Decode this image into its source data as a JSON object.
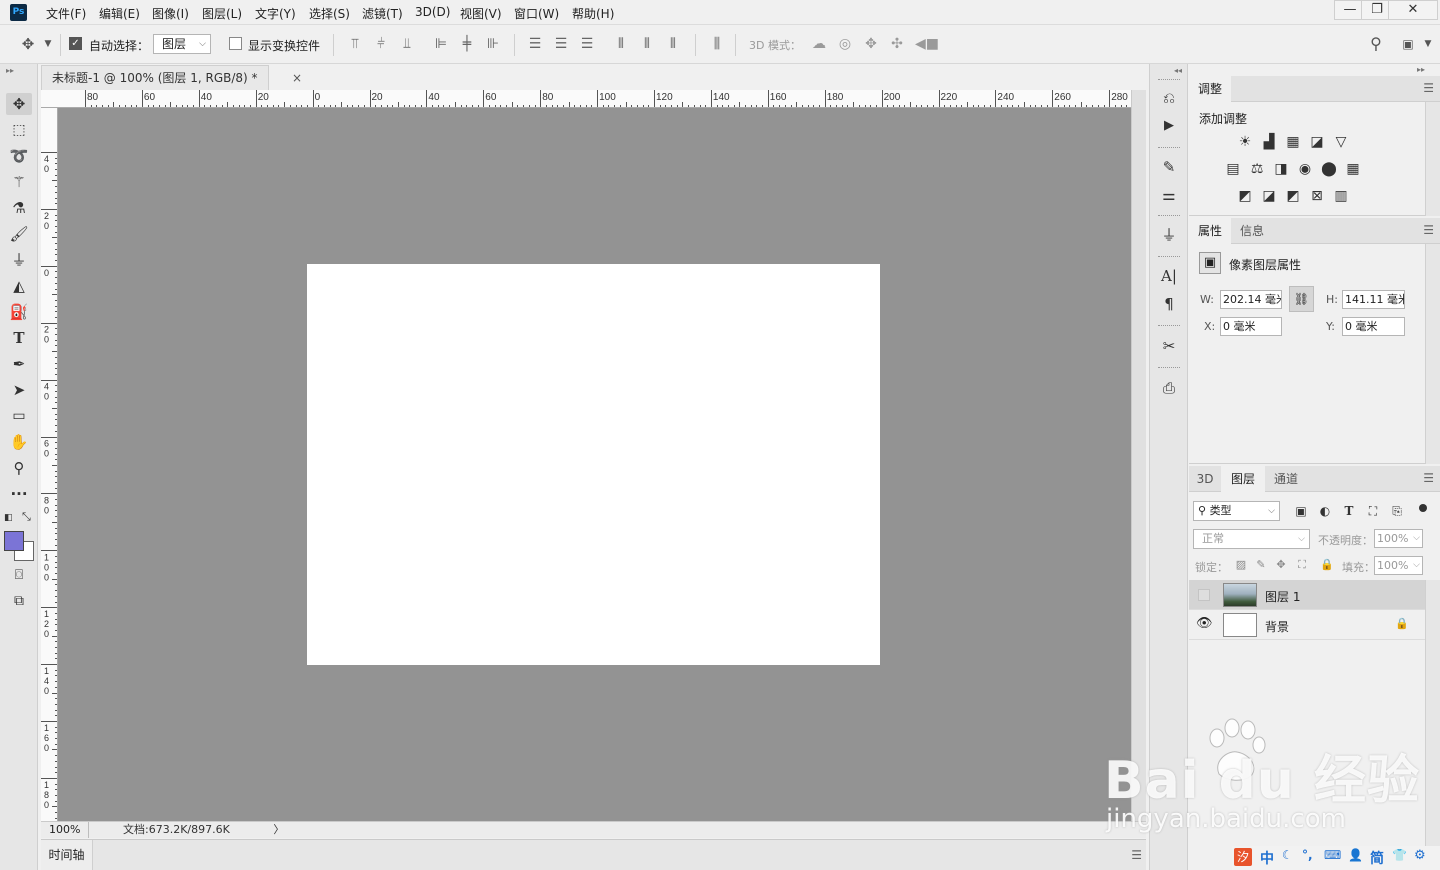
{
  "app": {
    "logo": "Ps"
  },
  "menu": [
    "文件(F)",
    "编辑(E)",
    "图像(I)",
    "图层(L)",
    "文字(Y)",
    "选择(S)",
    "滤镜(T)",
    "3D(D)",
    "视图(V)",
    "窗口(W)",
    "帮助(H)"
  ],
  "window_controls": {
    "minimize": "—",
    "restore": "❐",
    "close": "✕"
  },
  "options_bar": {
    "auto_select_label": "自动选择：",
    "auto_select_checked": true,
    "auto_select_target": "图层",
    "show_transform_label": "显示变换控件",
    "show_transform_checked": false,
    "mode_3d_label": "3D 模式："
  },
  "document": {
    "tab_title": "未标题-1 @ 100% (图层 1, RGB/8) *",
    "ruler_top_labels": [
      "80",
      "60",
      "40",
      "20",
      "0",
      "20",
      "40",
      "60",
      "80",
      "100",
      "120",
      "140",
      "160",
      "180",
      "200",
      "220",
      "240",
      "260",
      "280"
    ],
    "ruler_left_labels": [
      "4\n0",
      "2\n0",
      "0",
      "2\n0",
      "4\n0",
      "6\n0",
      "8\n0",
      "1\n0\n0",
      "1\n2\n0",
      "1\n4\n0",
      "1\n6\n0",
      "1\n8\n0"
    ],
    "zoom": "100%",
    "doc_info": "文档:673.2K/897.6K",
    "doc_info_arrow": "〉"
  },
  "timeline": {
    "tab_label": "时间轴"
  },
  "panels": {
    "adjustments": {
      "tab_label": "调整",
      "add_label": "添加调整"
    },
    "properties": {
      "tabs": [
        "属性",
        "信息"
      ],
      "title": "像素图层属性",
      "w_label": "W:",
      "w_value": "202.14 毫米",
      "h_label": "H:",
      "h_value": "141.11 毫米",
      "x_label": "X:",
      "x_value": "0 毫米",
      "y_label": "Y:",
      "y_value": "0 毫米"
    },
    "layers": {
      "tabs": [
        "3D",
        "图层",
        "通道"
      ],
      "filter_label": "类型",
      "blend_mode": "正常",
      "opacity_label": "不透明度：",
      "opacity_value": "100%",
      "lock_label": "锁定：",
      "fill_label": "填充：",
      "fill_value": "100%",
      "items": [
        {
          "name": "图层 1",
          "visible": false,
          "selected": true,
          "locked": false
        },
        {
          "name": "背景",
          "visible": true,
          "selected": false,
          "locked": true
        }
      ]
    }
  },
  "watermark": {
    "main": "Bai du 经验",
    "sub": "jingyan.baidu.com"
  },
  "ime": {
    "items": [
      "中",
      "简"
    ]
  },
  "colors": {
    "foreground": "#7b74d6",
    "background": "#ffffff",
    "pasteboard": "#939393"
  }
}
